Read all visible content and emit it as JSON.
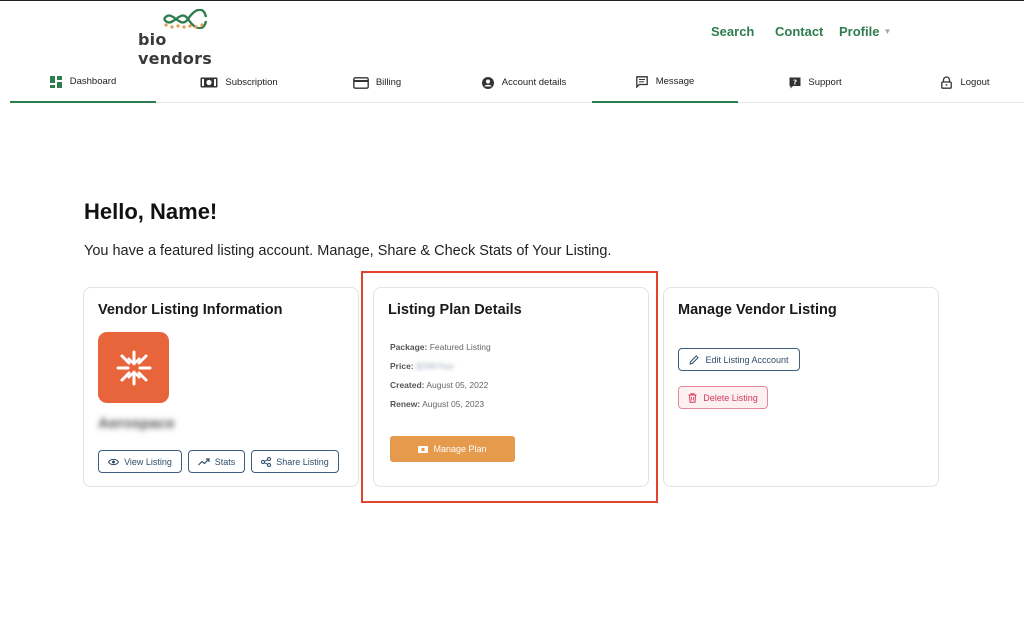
{
  "brand": {
    "name": "bio vendors"
  },
  "top_nav": {
    "search": "Search",
    "contact": "Contact",
    "profile": "Profile"
  },
  "tabs": [
    {
      "label": "Dashboard",
      "icon": "dashboard-icon"
    },
    {
      "label": "Subscription",
      "icon": "subscription-icon"
    },
    {
      "label": "Billing",
      "icon": "credit-card-icon"
    },
    {
      "label": "Account details",
      "icon": "user-circle-icon"
    },
    {
      "label": "Message",
      "icon": "message-icon"
    },
    {
      "label": "Support",
      "icon": "help-icon"
    },
    {
      "label": "Logout",
      "icon": "lock-icon"
    }
  ],
  "greeting": "Hello, Name!",
  "subtitle": "You have a featured listing account. Manage, Share & Check Stats of Your Listing.",
  "vendor_card": {
    "title": "Vendor Listing Information",
    "vendor_name": "Aerospace",
    "buttons": {
      "view": "View Listing",
      "stats": "Stats",
      "share": "Share Listing"
    }
  },
  "plan_card": {
    "title": "Listing Plan Details",
    "package_label": "Package:",
    "package_value": "Featured Listing",
    "price_label": "Price:",
    "price_value": "$299/Year",
    "created_label": "Created:",
    "created_value": "August 05, 2022",
    "renew_label": "Renew:",
    "renew_value": "August 05, 2023",
    "manage_button": "Manage Plan"
  },
  "manage_card": {
    "title": "Manage Vendor Listing",
    "edit_button": "Edit Listing Acccount",
    "delete_button": "Delete Listing"
  },
  "colors": {
    "brand_green": "#2e7d4f",
    "orange": "#e59a4c",
    "vendor_logo": "#e8653b",
    "highlight": "#e0442e",
    "danger": "#d6395d"
  }
}
